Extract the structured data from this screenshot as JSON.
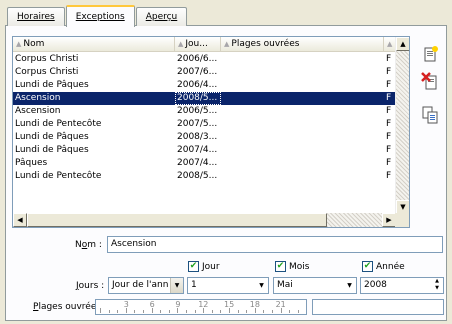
{
  "tabs": [
    {
      "label": "Horaires",
      "active": false
    },
    {
      "label": "Exceptions",
      "active": true
    },
    {
      "label": "Aperçu",
      "active": false
    }
  ],
  "columns": [
    "Nom",
    "Jou...",
    "Plages ouvrées",
    ""
  ],
  "rows": [
    {
      "name": "Corpus Christi",
      "day": "2006/6...",
      "plages": "",
      "flag": "F"
    },
    {
      "name": "Corpus Christi",
      "day": "2007/6...",
      "plages": "",
      "flag": "F"
    },
    {
      "name": "Lundi de Pâques",
      "day": "2006/4...",
      "plages": "",
      "flag": "F"
    },
    {
      "name": "Ascension",
      "day": "2008/5...",
      "plages": "",
      "flag": "F",
      "selected": true
    },
    {
      "name": "Ascension",
      "day": "2006/5...",
      "plages": "",
      "flag": "F"
    },
    {
      "name": "Lundi de Pentecôte",
      "day": "2007/5...",
      "plages": "",
      "flag": "F"
    },
    {
      "name": "Lundi de Pâques",
      "day": "2008/3...",
      "plages": "",
      "flag": "F"
    },
    {
      "name": "Lundi de Pâques",
      "day": "2007/4...",
      "plages": "",
      "flag": "F"
    },
    {
      "name": "Pâques",
      "day": "2007/4...",
      "plages": "",
      "flag": "F"
    },
    {
      "name": "Lundi de Pentecôte",
      "day": "2008/5...",
      "plages": "",
      "flag": "F"
    }
  ],
  "side_buttons": [
    {
      "icon": "new-document-icon"
    },
    {
      "icon": "delete-icon"
    },
    {
      "icon": "duplicate-icon"
    }
  ],
  "form": {
    "nom_label_pre": "N",
    "nom_label_u": "o",
    "nom_label_post": "m :",
    "nom_value": "Ascension",
    "jour_check": "Jour",
    "mois_check": "Mois",
    "annee_check": "Année",
    "jours_label_u": "J",
    "jours_label_post": "ours :",
    "jours_type": "Jour de l'ann",
    "jour_value": "1",
    "mois_value": "Mai",
    "annee_value": "2008",
    "plages_label_u": "P",
    "plages_label_post": "lages ouvrées :",
    "ruler_labels": [
      "3",
      "6",
      "9",
      "12",
      "15",
      "18",
      "21"
    ]
  },
  "colors": {
    "selection": "#0a246a",
    "tab_accent": "#ffc83c",
    "check": "#21a121"
  }
}
